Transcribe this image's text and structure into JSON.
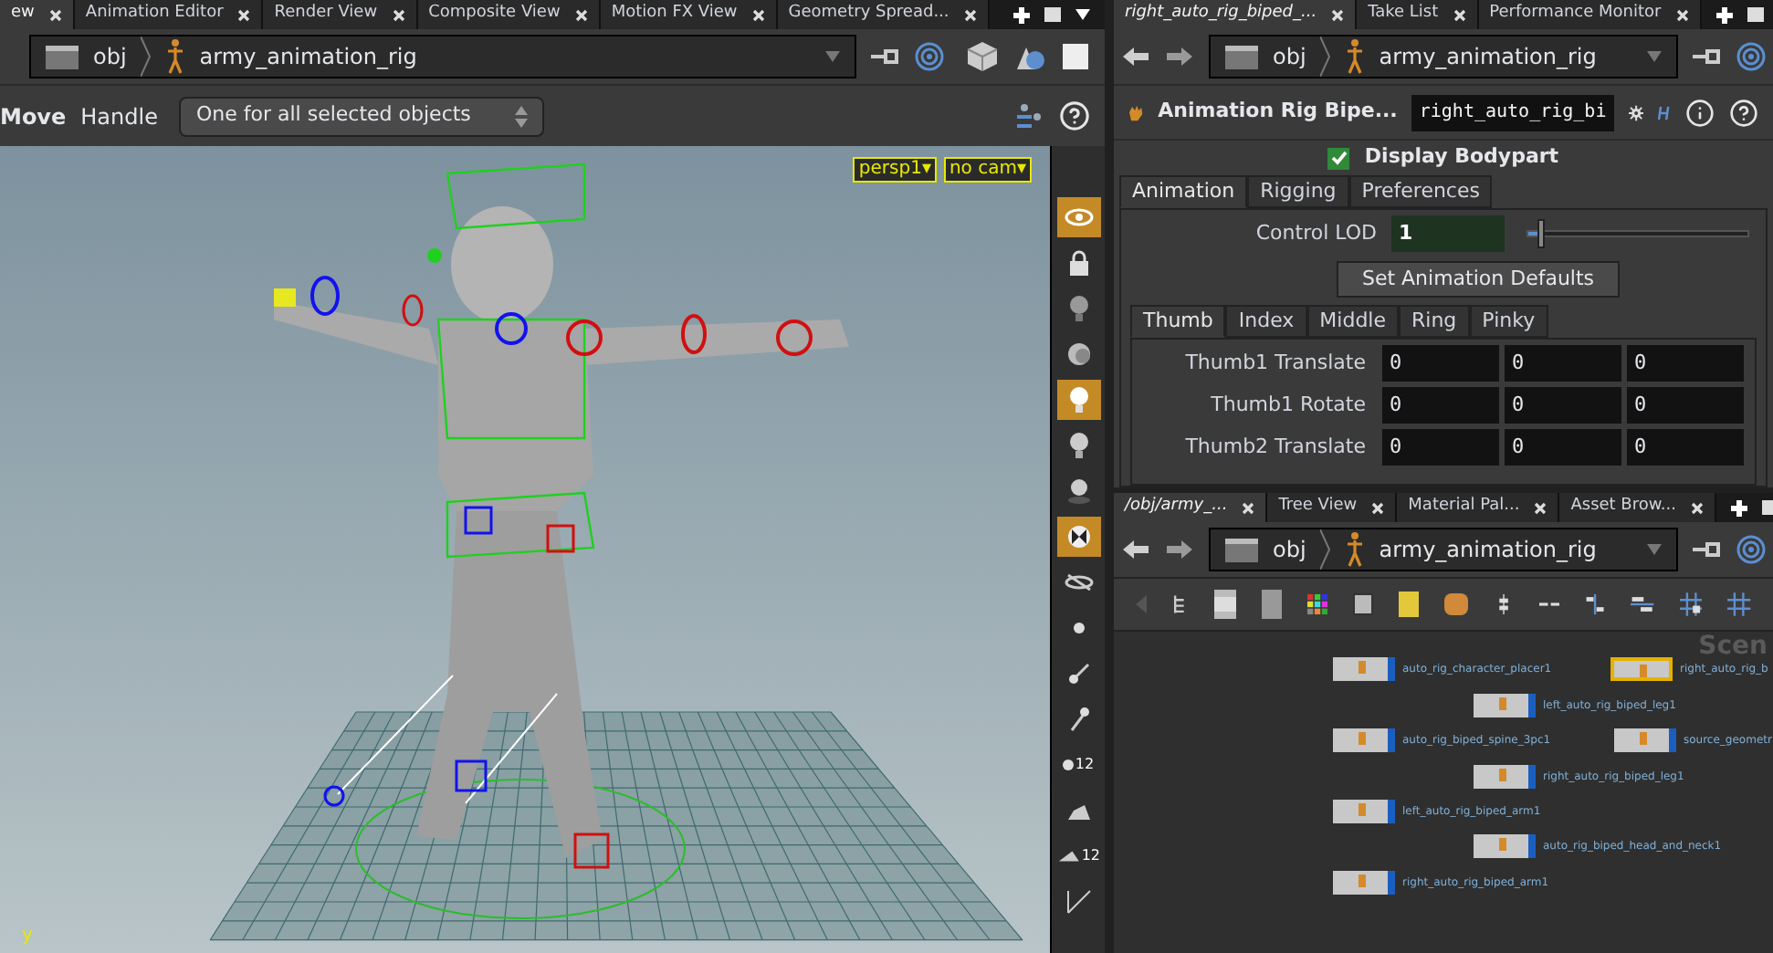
{
  "left_pane": {
    "tabs": [
      {
        "label": "ew",
        "selected": true
      },
      {
        "label": "Animation Editor",
        "selected": false
      },
      {
        "label": "Render View",
        "selected": false
      },
      {
        "label": "Composite View",
        "selected": false
      },
      {
        "label": "Motion FX View",
        "selected": false
      },
      {
        "label": "Geometry Spread...",
        "selected": false
      }
    ],
    "path": [
      "obj",
      "army_animation_rig"
    ],
    "tool_options": {
      "tool": "Move",
      "handle_label": "Handle",
      "handle_value": "One for all selected objects"
    },
    "viewport": {
      "camera_menus": [
        "persp1▾",
        "no cam▾"
      ],
      "axis_label": "y"
    },
    "display_toolbar": [
      {
        "selected": true
      },
      {
        "selected": false
      },
      {
        "selected": false
      },
      {
        "selected": false
      },
      {
        "selected": true
      },
      {
        "selected": false
      },
      {
        "selected": false
      },
      {
        "selected": true
      },
      {
        "selected": false
      },
      {
        "selected": false
      },
      {
        "selected": false
      },
      {
        "selected": false
      },
      {
        "selected": false,
        "label": "12"
      },
      {
        "selected": false
      },
      {
        "selected": false,
        "label": "12"
      },
      {
        "selected": false
      }
    ]
  },
  "parameter_pane": {
    "tabs": [
      {
        "label": "right_auto_rig_biped_...",
        "selected": true
      },
      {
        "label": "Take List",
        "selected": false
      },
      {
        "label": "Performance Monitor",
        "selected": false
      }
    ],
    "path": [
      "obj",
      "army_animation_rig"
    ],
    "node_type": "Animation Rig Bipe...",
    "node_name": "right_auto_rig_bi",
    "display_bodypart": {
      "label": "Display Bodypart",
      "checked": true
    },
    "sections": [
      {
        "label": "Animation",
        "selected": true
      },
      {
        "label": "Rigging",
        "selected": false
      },
      {
        "label": "Preferences",
        "selected": false
      }
    ],
    "control_lod": {
      "label": "Control LOD",
      "value": "1",
      "level": 0.05
    },
    "defaults_button": "Set Animation Defaults",
    "fingers": [
      {
        "label": "Thumb",
        "selected": true
      },
      {
        "label": "Index",
        "selected": false
      },
      {
        "label": "Middle",
        "selected": false
      },
      {
        "label": "Ring",
        "selected": false
      },
      {
        "label": "Pinky",
        "selected": false
      }
    ],
    "rows": [
      {
        "label": "Thumb1 Translate",
        "values": [
          "0",
          "0",
          "0"
        ]
      },
      {
        "label": "Thumb1 Rotate",
        "values": [
          "0",
          "0",
          "0"
        ]
      },
      {
        "label": "Thumb2 Translate",
        "values": [
          "0",
          "0",
          "0"
        ]
      }
    ]
  },
  "network_pane": {
    "tabs": [
      {
        "label": "/obj/army_...",
        "selected": true
      },
      {
        "label": "Tree View",
        "selected": false
      },
      {
        "label": "Material Pal...",
        "selected": false
      },
      {
        "label": "Asset Brow...",
        "selected": false
      }
    ],
    "path": [
      "obj",
      "army_animation_rig"
    ],
    "background_label": "Scen",
    "nodes": [
      {
        "name": "auto_rig_character_placer1",
        "selected": false
      },
      {
        "name": "right_auto_rig_b",
        "selected": true
      },
      {
        "name": "left_auto_rig_biped_leg1",
        "selected": false
      },
      {
        "name": "auto_rig_biped_spine_3pc1",
        "selected": false
      },
      {
        "name": "source_geometr",
        "selected": false
      },
      {
        "name": "right_auto_rig_biped_leg1",
        "selected": false
      },
      {
        "name": "left_auto_rig_biped_arm1",
        "selected": false
      },
      {
        "name": "auto_rig_biped_head_and_neck1",
        "selected": false
      },
      {
        "name": "right_auto_rig_biped_arm1",
        "selected": false
      }
    ]
  }
}
